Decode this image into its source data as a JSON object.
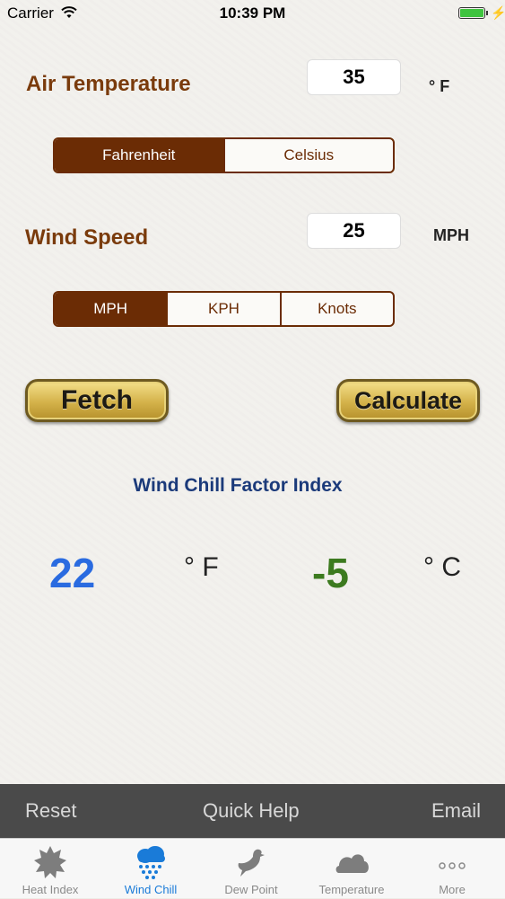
{
  "status_bar": {
    "carrier": "Carrier",
    "time": "10:39 PM"
  },
  "air_temperature": {
    "label": "Air Temperature",
    "value": "35",
    "unit": "° F",
    "units": [
      "Fahrenheit",
      "Celsius"
    ],
    "selected_unit": "Fahrenheit"
  },
  "wind_speed": {
    "label": "Wind Speed",
    "value": "25",
    "unit": "MPH",
    "units": [
      "MPH",
      "KPH",
      "Knots"
    ],
    "selected_unit": "MPH"
  },
  "buttons": {
    "fetch": "Fetch",
    "calculate": "Calculate"
  },
  "result": {
    "title": "Wind Chill Factor Index",
    "fahrenheit": "22",
    "fahrenheit_unit": "° F",
    "celsius": "-5",
    "celsius_unit": "° C"
  },
  "action_bar": {
    "reset": "Reset",
    "quick_help": "Quick Help",
    "email": "Email"
  },
  "tabs": [
    {
      "label": "Heat Index",
      "icon": "sun-icon",
      "active": false
    },
    {
      "label": "Wind Chill",
      "icon": "snow-cloud-icon",
      "active": true
    },
    {
      "label": "Dew Point",
      "icon": "bird-icon",
      "active": false
    },
    {
      "label": "Temperature",
      "icon": "cloud-icon",
      "active": false
    },
    {
      "label": "More",
      "icon": "more-dots-icon",
      "active": false
    }
  ],
  "colors": {
    "accent_brown": "#6b2c05",
    "result_blue": "#2a6be0",
    "result_green": "#3c7a1f",
    "tab_active": "#1a7bd8"
  }
}
